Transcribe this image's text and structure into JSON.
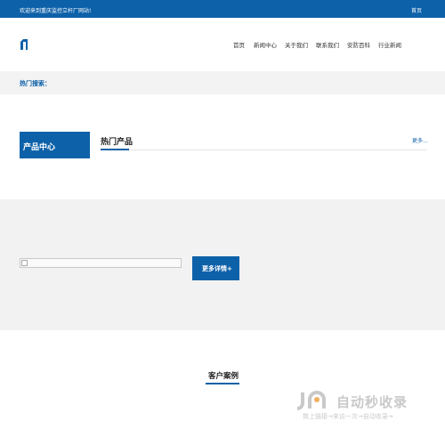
{
  "topbar": {
    "welcome": "欢迎来到重庆监控立杆厂网站!",
    "home_link": "首页"
  },
  "nav": {
    "items": [
      "首页",
      "新闻中心",
      "关于我们",
      "联系我们",
      "安防百科",
      "行业新闻"
    ]
  },
  "hot_search": {
    "label": "热门搜索："
  },
  "products": {
    "category_title": "产品中心",
    "hot_title": "热门产品",
    "more_link": "更多..."
  },
  "feature": {
    "detail_button": "更多详情+"
  },
  "cases": {
    "title": "客户案例"
  },
  "watermark": {
    "main": "自动秒收录",
    "sub": "致上链接→来访一次→自动收录→"
  },
  "colors": {
    "brand": "#0d61a9",
    "band": "#f2f2f2"
  }
}
